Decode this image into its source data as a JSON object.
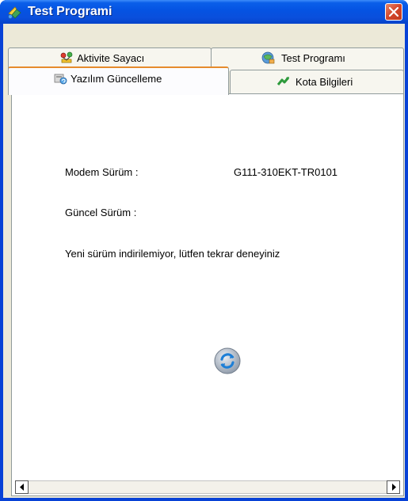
{
  "window": {
    "title": "Test Programi",
    "icon": "app-icon",
    "close_icon": "close-icon"
  },
  "tabs_row_back": [
    {
      "label": "Aktivite Sayacı",
      "icon": "activity-counter-icon"
    },
    {
      "label": "Test Programı",
      "icon": "test-program-icon"
    }
  ],
  "tabs_row_front": [
    {
      "label": "Yazılım Güncelleme",
      "icon": "software-update-icon",
      "active": true
    },
    {
      "label": "Kota Bilgileri",
      "icon": "quota-info-icon",
      "active": false
    }
  ],
  "panel": {
    "modem_version_label": "Modem Sürüm :",
    "modem_version_value": "G111-310EKT-TR0101",
    "current_version_label": "Güncel Sürüm :",
    "current_version_value": "",
    "status_message": "Yeni sürüm indirilemiyor, lütfen tekrar deneyiniz",
    "refresh_icon": "refresh-icon"
  },
  "colors": {
    "titlebar": "#0553e2",
    "close_button": "#d2462b",
    "active_tab_accent": "#e68b2c",
    "dialog_bg": "#ece9d8"
  }
}
